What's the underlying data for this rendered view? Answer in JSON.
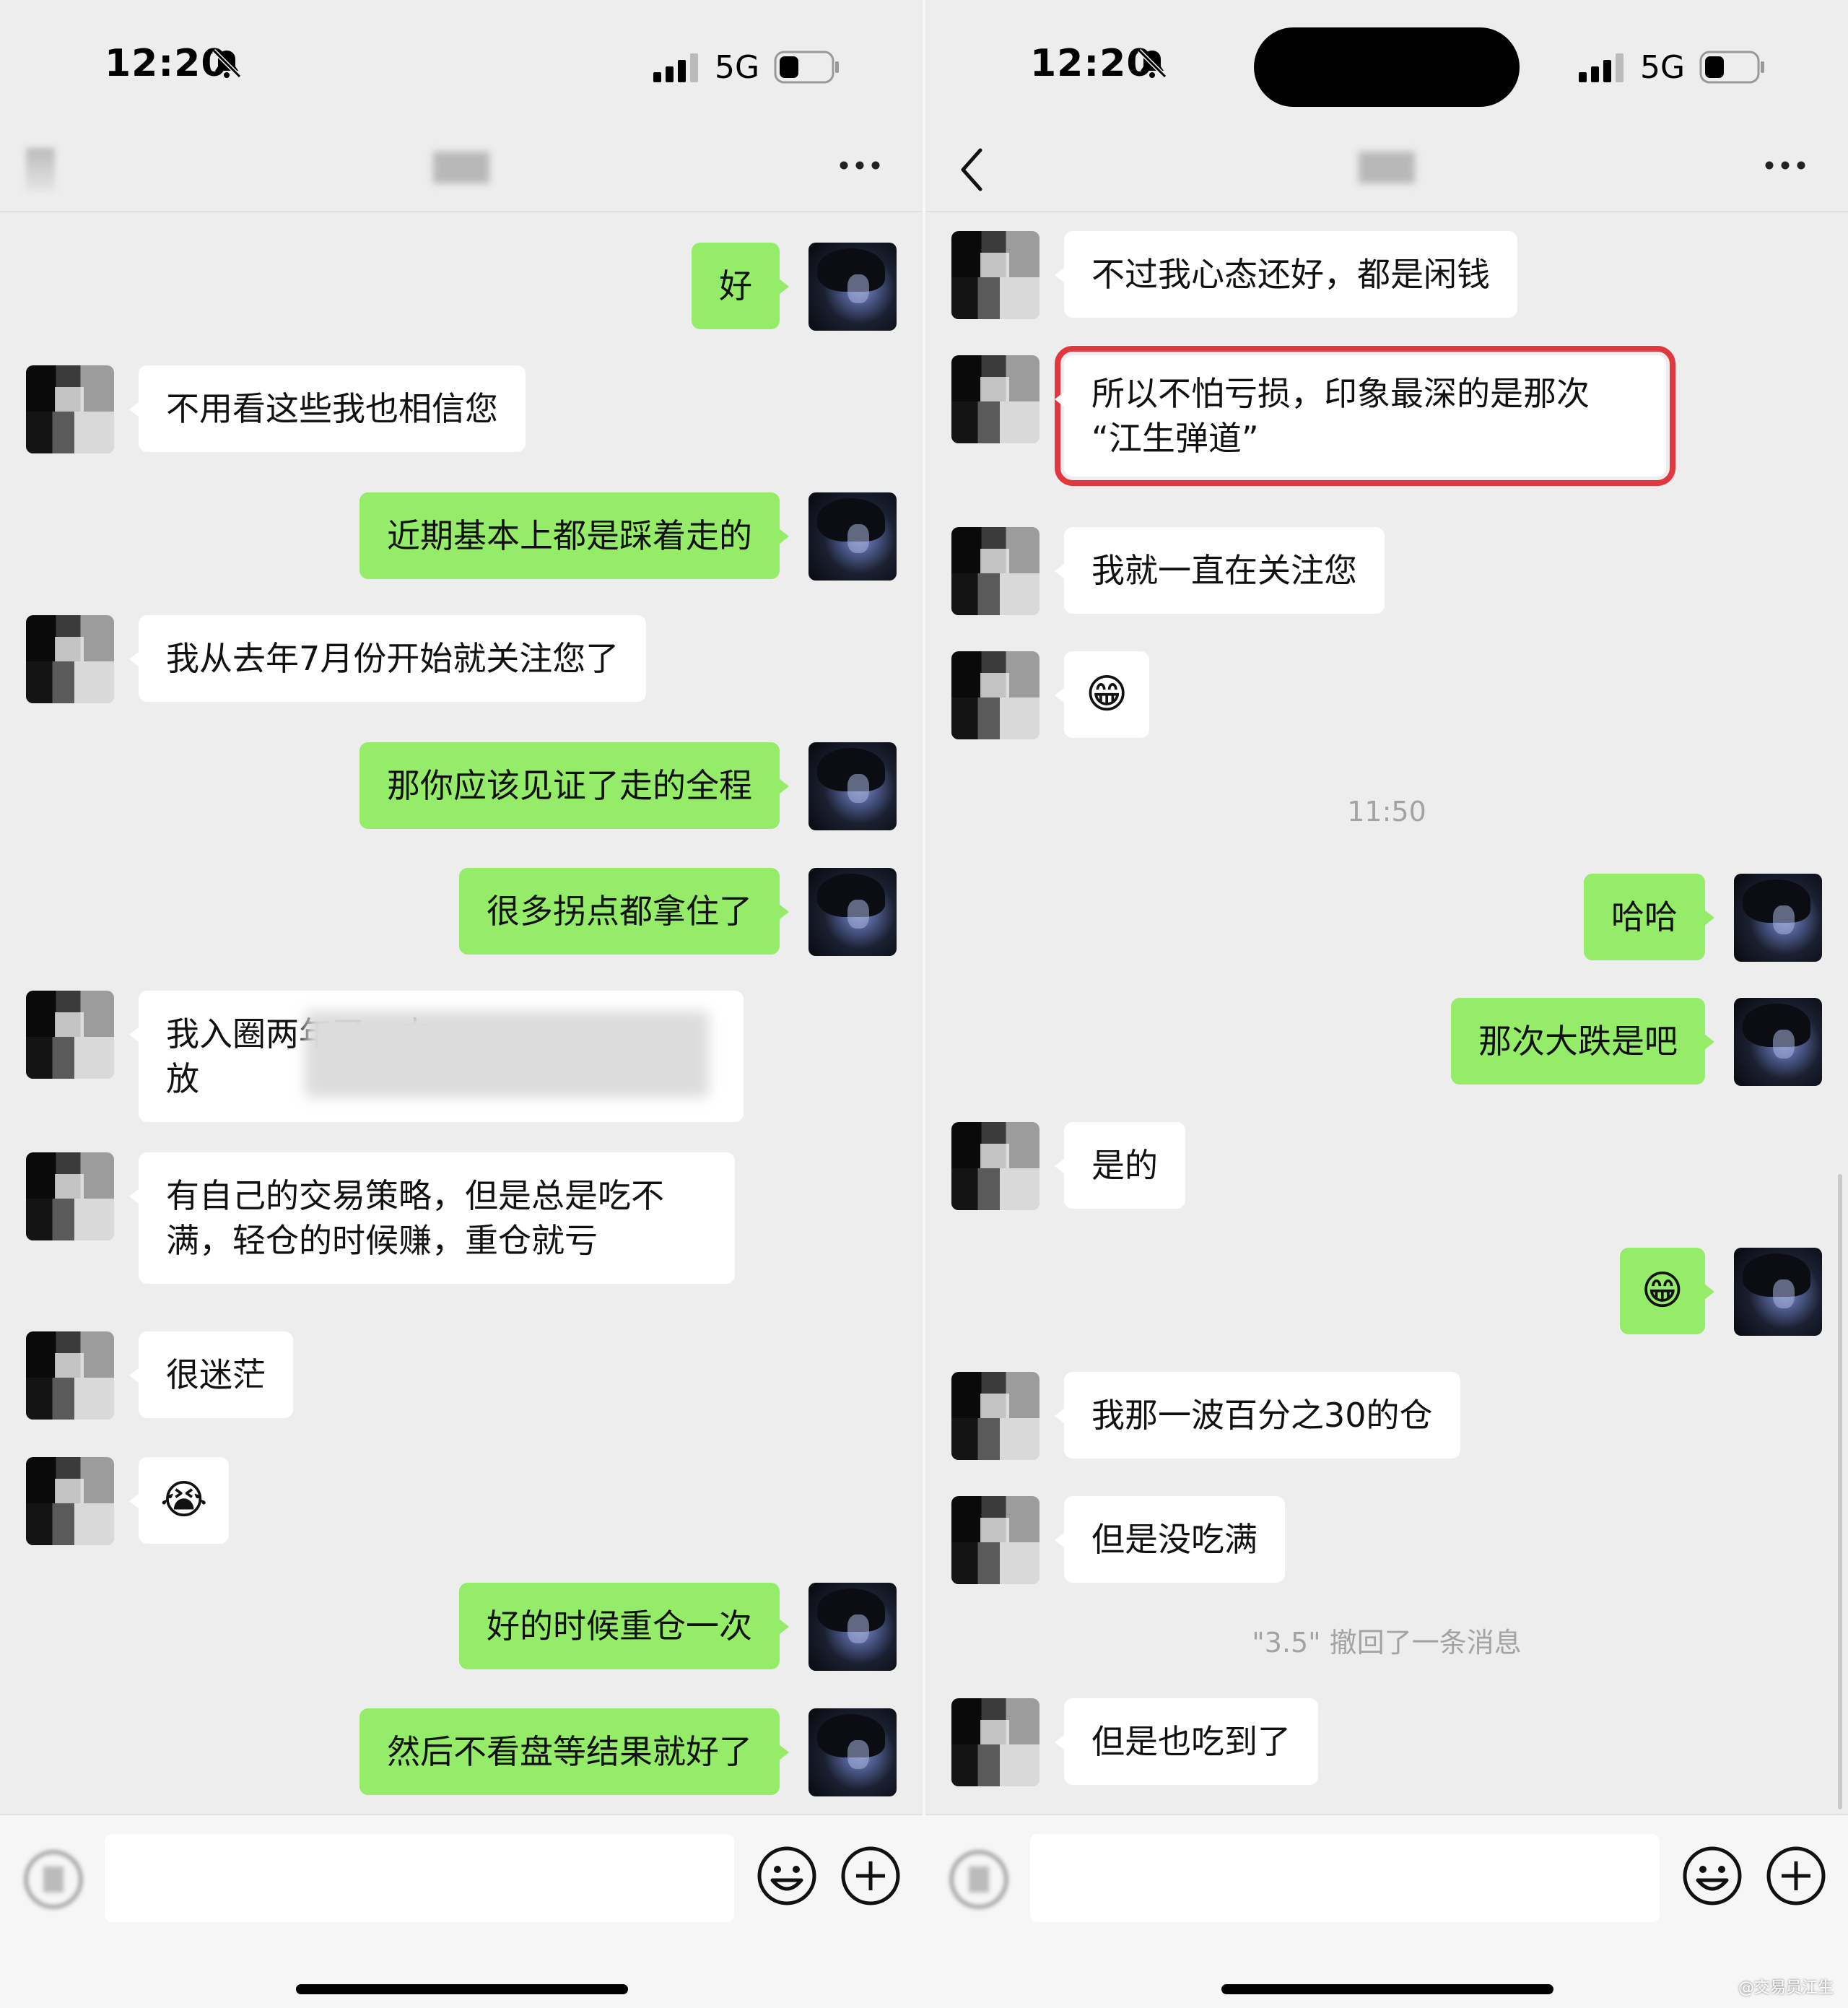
{
  "status_bar": {
    "time": "12:20",
    "network": "5G"
  },
  "left_panel": {
    "messages": [
      {
        "dir": "out",
        "text": "好"
      },
      {
        "dir": "in",
        "text": "不用看这些我也相信您"
      },
      {
        "dir": "out",
        "text": "近期基本上都是踩着走的"
      },
      {
        "dir": "in",
        "text": "我从去年7月份开始就关注您了"
      },
      {
        "dir": "out",
        "text": "那你应该见证了走的全程"
      },
      {
        "dir": "out",
        "text": "很多拐点都拿住了"
      },
      {
        "dir": "in",
        "line1": "我入圈两年了，中",
        "line2": "放"
      },
      {
        "dir": "in",
        "text": "有自己的交易策略，但是总是吃不满，轻仓的时候赚，重仓就亏"
      },
      {
        "dir": "in",
        "text": "很迷茫"
      },
      {
        "dir": "in",
        "emoji": "😭"
      },
      {
        "dir": "out",
        "text": "好的时候重仓一次"
      },
      {
        "dir": "out",
        "text": "然后不看盘等结果就好了"
      }
    ]
  },
  "right_panel": {
    "messages": [
      {
        "dir": "in",
        "text": "不过我心态还好，都是闲钱"
      },
      {
        "dir": "in",
        "line1": "所以不怕亏损，印象最深的是那次",
        "line2": "“江生弹道”"
      },
      {
        "dir": "in",
        "text": "我就一直在关注您"
      },
      {
        "dir": "in",
        "emoji": "😁"
      },
      {
        "timestamp": "11:50"
      },
      {
        "dir": "out",
        "text": "哈哈"
      },
      {
        "dir": "out",
        "text": "那次大跌是吧"
      },
      {
        "dir": "in",
        "text": "是的"
      },
      {
        "dir": "out",
        "emoji": "😁"
      },
      {
        "dir": "in",
        "text": "我那一波百分之30的仓"
      },
      {
        "dir": "in",
        "text": "但是没吃满"
      },
      {
        "system": "\"3.5\" 撤回了一条消息"
      },
      {
        "dir": "in",
        "text": "但是也吃到了"
      }
    ]
  },
  "watermark": "@交易员江生"
}
